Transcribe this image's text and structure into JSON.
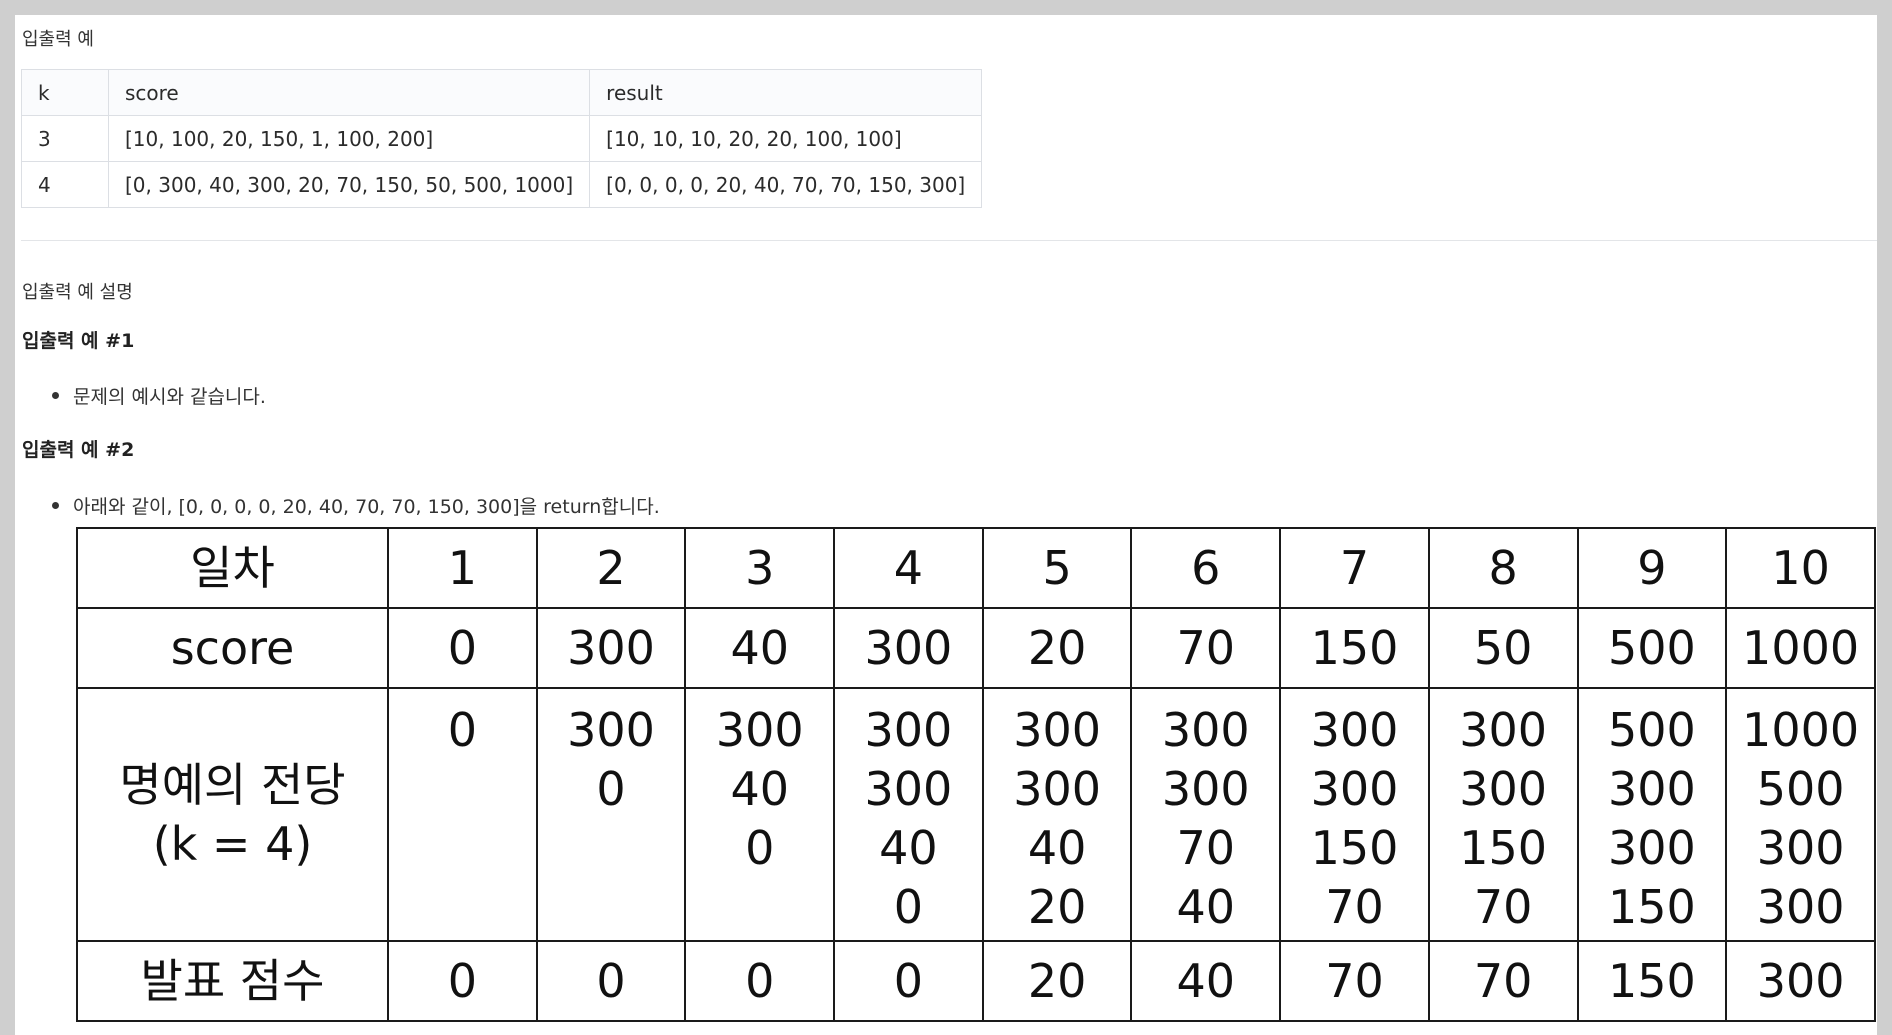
{
  "io_section": {
    "title": "입출력 예",
    "columns": [
      "k",
      "score",
      "result"
    ],
    "rows": [
      [
        "3",
        "[10, 100, 20, 150, 1, 100, 200]",
        "[10, 10, 10, 20, 20, 100, 100]"
      ],
      [
        "4",
        "[0, 300, 40, 300, 20, 70, 150, 50, 500, 1000]",
        "[0, 0, 0, 0, 20, 40, 70, 70, 150, 300]"
      ]
    ]
  },
  "explanation": {
    "title": "입출력 예 설명",
    "example1": {
      "heading": "입출력 예 #1",
      "bullet": "문제의 예시와 같습니다."
    },
    "example2": {
      "heading": "입출력 예 #2",
      "bullet": "아래와 같이, [0, 0, 0, 0, 20, 40, 70, 70, 150, 300]을 return합니다."
    }
  },
  "hall_of_fame_table": {
    "row_headers": {
      "day": "일차",
      "score": "score",
      "hall_line1": "명예의 전당",
      "hall_line2": "(k = 4)",
      "announced": "발표 점수"
    },
    "days": [
      "1",
      "2",
      "3",
      "4",
      "5",
      "6",
      "7",
      "8",
      "9",
      "10"
    ],
    "scores": [
      "0",
      "300",
      "40",
      "300",
      "20",
      "70",
      "150",
      "50",
      "500",
      "1000"
    ],
    "hall": [
      [
        "0"
      ],
      [
        "300",
        "0"
      ],
      [
        "300",
        "40",
        "0"
      ],
      [
        "300",
        "300",
        "40",
        "0"
      ],
      [
        "300",
        "300",
        "40",
        "20"
      ],
      [
        "300",
        "300",
        "70",
        "40"
      ],
      [
        "300",
        "300",
        "150",
        "70"
      ],
      [
        "300",
        "300",
        "150",
        "70"
      ],
      [
        "500",
        "300",
        "300",
        "150"
      ],
      [
        "1000",
        "500",
        "300",
        "300"
      ]
    ],
    "announced": [
      "0",
      "0",
      "0",
      "0",
      "20",
      "40",
      "70",
      "70",
      "150",
      "300"
    ]
  }
}
